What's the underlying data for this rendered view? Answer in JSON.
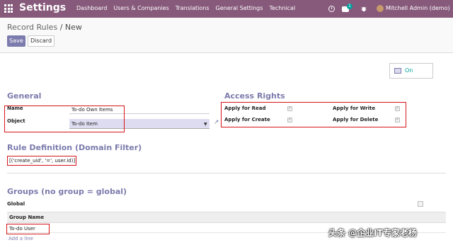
{
  "navbar": {
    "app_title": "Settings",
    "menu": [
      "Dashboard",
      "Users & Companies",
      "Translations",
      "General Settings",
      "Technical"
    ],
    "chat_count": "1",
    "user_name": "Mitchell Admin (demo)"
  },
  "breadcrumb": {
    "parent": "Record Rules",
    "separator": "/",
    "current": "New"
  },
  "buttons": {
    "save": "Save",
    "discard": "Discard"
  },
  "toggle": {
    "label": "On"
  },
  "general": {
    "title": "General",
    "name_label": "Name",
    "name_value": "To-do Own Items",
    "object_label": "Object",
    "object_value": "To-do Item"
  },
  "access_rights": {
    "title": "Access Rights",
    "read": "Apply for Read",
    "write": "Apply for Write",
    "create": "Apply for Create",
    "delete": "Apply for Delete"
  },
  "rule_definition": {
    "title": "Rule Definition (Domain Filter)",
    "domain": "[('create_uid', '=', user.id)]"
  },
  "groups": {
    "title": "Groups (no group = global)",
    "global_label": "Global",
    "column": "Group Name",
    "rows": [
      "To-do User"
    ],
    "add_line": "Add a line"
  },
  "watermark": "头条 @企业IT专家老杨",
  "colors": {
    "navbar": "#875a7b",
    "primary": "#7c7bad",
    "highlight": "#d7141a",
    "toggle_on": "#00a09d"
  }
}
